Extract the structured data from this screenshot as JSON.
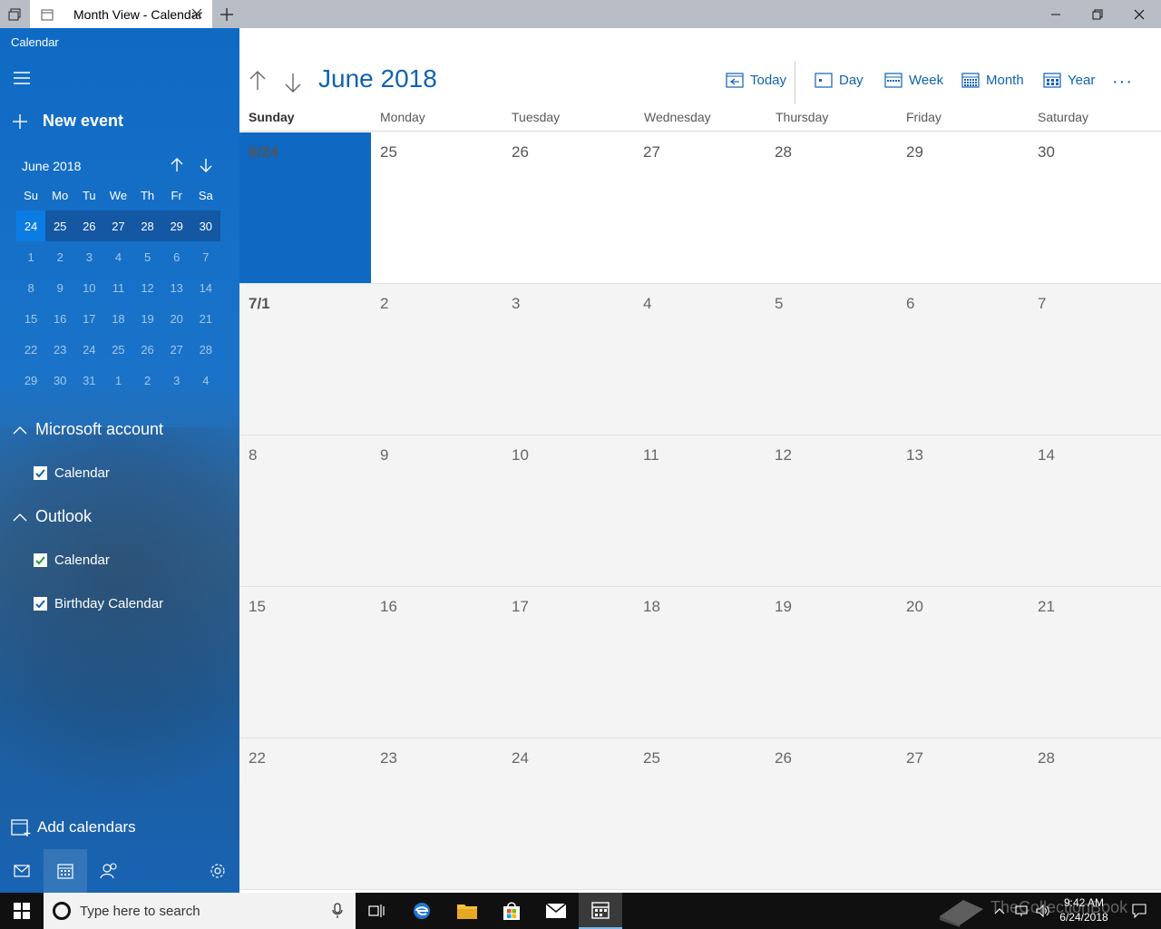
{
  "window": {
    "tab_title": "Month View - Calendar"
  },
  "sidebar": {
    "app_name": "Calendar",
    "new_event_label": "New event",
    "mini_calendar": {
      "title": "June 2018",
      "dow": [
        "Su",
        "Mo",
        "Tu",
        "We",
        "Th",
        "Fr",
        "Sa"
      ],
      "weeks": [
        [
          "24",
          "25",
          "26",
          "27",
          "28",
          "29",
          "30"
        ],
        [
          "1",
          "2",
          "3",
          "4",
          "5",
          "6",
          "7"
        ],
        [
          "8",
          "9",
          "10",
          "11",
          "12",
          "13",
          "14"
        ],
        [
          "15",
          "16",
          "17",
          "18",
          "19",
          "20",
          "21"
        ],
        [
          "22",
          "23",
          "24",
          "25",
          "26",
          "27",
          "28"
        ],
        [
          "29",
          "30",
          "31",
          "1",
          "2",
          "3",
          "4"
        ]
      ]
    },
    "accounts": [
      {
        "name": "Microsoft account",
        "calendars": [
          "Calendar"
        ]
      },
      {
        "name": "Outlook",
        "calendars": [
          "Calendar",
          "Birthday Calendar"
        ]
      }
    ],
    "add_calendars_label": "Add calendars"
  },
  "main": {
    "title": "June 2018",
    "views": {
      "today": "Today",
      "day": "Day",
      "week": "Week",
      "month": "Month",
      "year": "Year"
    },
    "more": "···",
    "dow": [
      "Sunday",
      "Monday",
      "Tuesday",
      "Wednesday",
      "Thursday",
      "Friday",
      "Saturday"
    ],
    "weeks": [
      [
        "6/24",
        "25",
        "26",
        "27",
        "28",
        "29",
        "30"
      ],
      [
        "7/1",
        "2",
        "3",
        "4",
        "5",
        "6",
        "7"
      ],
      [
        "8",
        "9",
        "10",
        "11",
        "12",
        "13",
        "14"
      ],
      [
        "15",
        "16",
        "17",
        "18",
        "19",
        "20",
        "21"
      ],
      [
        "22",
        "23",
        "24",
        "25",
        "26",
        "27",
        "28"
      ]
    ]
  },
  "taskbar": {
    "search_placeholder": "Type here to search",
    "time": "9:42 AM",
    "date": "6/24/2018"
  },
  "watermark": "TheCollectionBook",
  "colors": {
    "accent": "#1062b2",
    "today_fill": "#0f68c2",
    "sidebar": "#1a73c9"
  }
}
